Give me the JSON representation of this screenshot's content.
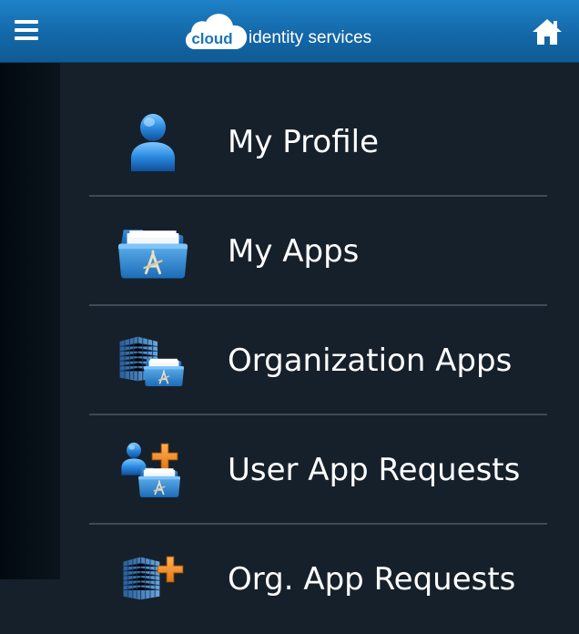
{
  "header": {
    "logo_cloud": "cloud",
    "logo_text": "identity services",
    "menu_icon": "hamburger-menu-icon",
    "home_icon": "home-icon"
  },
  "menu": {
    "items": [
      {
        "label": "My Profile",
        "icon": "user-icon"
      },
      {
        "label": "My Apps",
        "icon": "app-folder-icon"
      },
      {
        "label": "Organization Apps",
        "icon": "organization-apps-icon"
      },
      {
        "label": "User App Requests",
        "icon": "user-app-request-icon"
      },
      {
        "label": "Org. App Requests",
        "icon": "org-app-request-icon"
      }
    ]
  },
  "colors": {
    "header_blue": "#1468a8",
    "background": "#16202b",
    "divider": "#3e4a55",
    "accent_orange": "#f08a1c"
  }
}
